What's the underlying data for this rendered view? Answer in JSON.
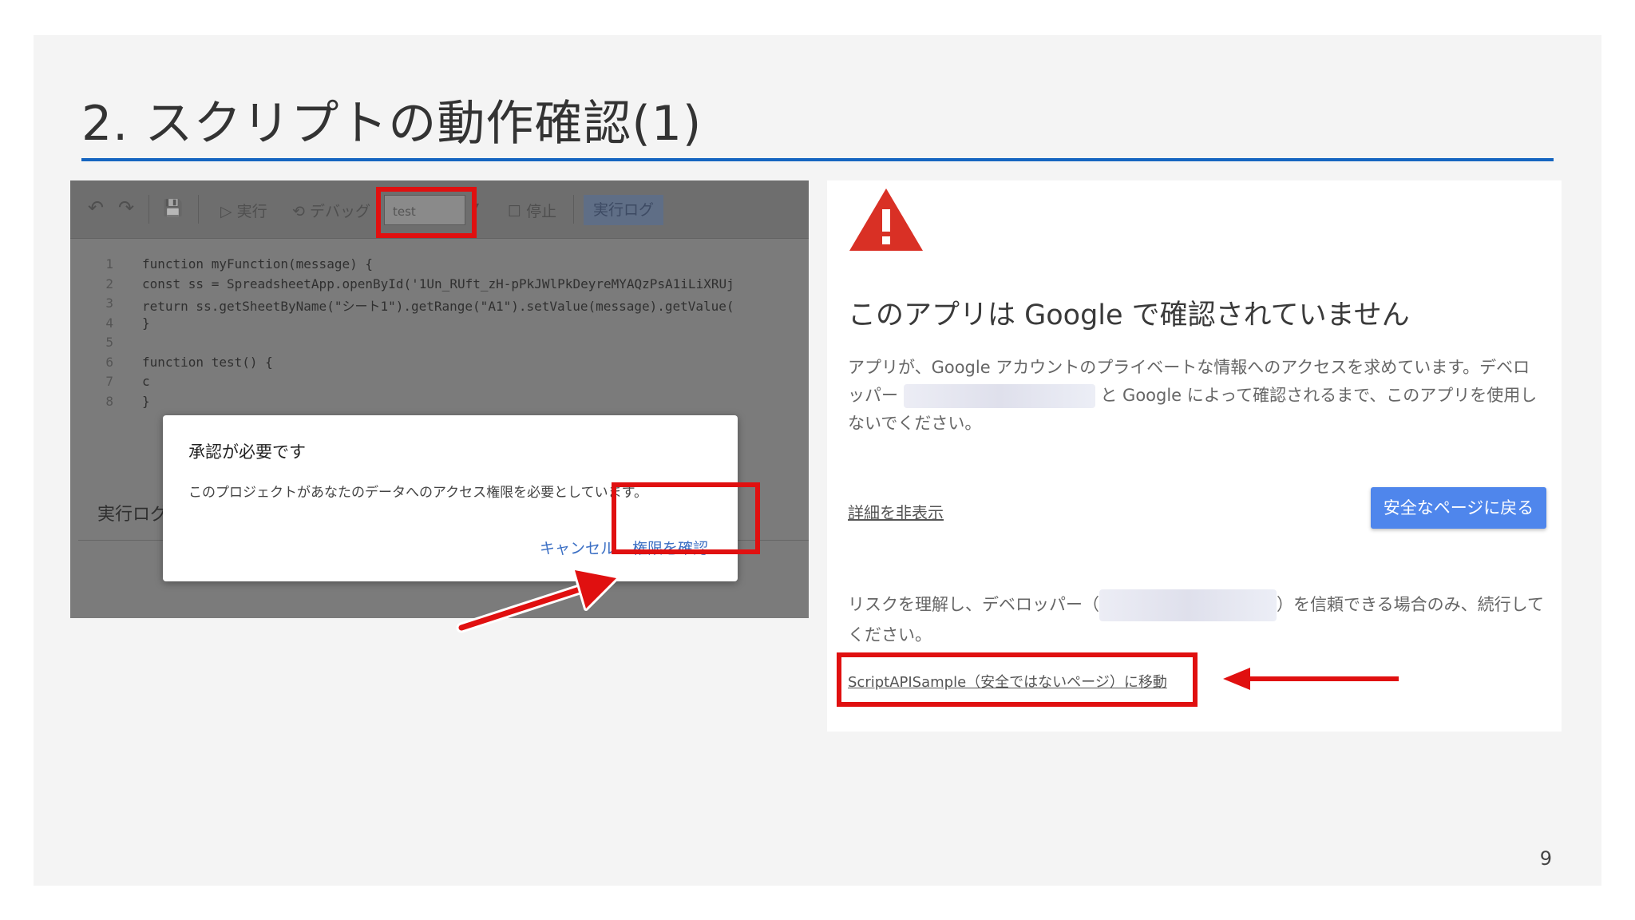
{
  "slide": {
    "title": "2. スクリプトの動作確認(1)",
    "page_number": "9",
    "accent_color": "#1565c0"
  },
  "editor": {
    "toolbar": {
      "undo_icon": "↶",
      "redo_icon": "↷",
      "save_icon": "💾",
      "run_label": "▷ 実行",
      "debug_label": "⟲ デバッグ",
      "function_select_value": "test",
      "stop_label": "停止",
      "log_label": "実行ログ"
    },
    "line_numbers": [
      "1",
      "2",
      "3",
      "4",
      "5",
      "6",
      "7",
      "8"
    ],
    "code_lines": [
      "function myFunction(message) {",
      "  const ss = SpreadsheetApp.openById('1Un_RUft_zH-pPkJWlPkDeyreMYAQzPsA1iLiXRUj",
      "  return ss.getSheetByName(\"シート1\").getRange(\"A1\").setValue(message).getValue(",
      "}",
      "",
      "function test() {",
      "  c",
      "}"
    ],
    "panel_label": "実行ログ",
    "dialog": {
      "title": "承認が必要です",
      "message": "このプロジェクトがあなたのデータへのアクセス権限を必要としています。",
      "cancel_label": "キャンセル",
      "confirm_label": "権限を確認"
    }
  },
  "oauth_warning": {
    "icon": "warning-triangle",
    "title": "このアプリは Google で確認されていません",
    "desc_part1": "アプリが、Google アカウントのプライベートな情報へのアクセスを求めています。デベロッパー",
    "desc_part2": "と Google によって確認されるまで、このアプリを使用しないでください。",
    "hide_details_label": "詳細を非表示",
    "back_to_safety_label": "安全なページに戻る",
    "risk_part1": "リスクを理解し、デベロッパー（",
    "risk_part2": "）を信頼できる場合のみ、続行してください。",
    "goto_link_label": "ScriptAPISample（安全ではないページ）に移動",
    "button_color": "#4f86ec"
  },
  "annotation_color": "#e01010"
}
